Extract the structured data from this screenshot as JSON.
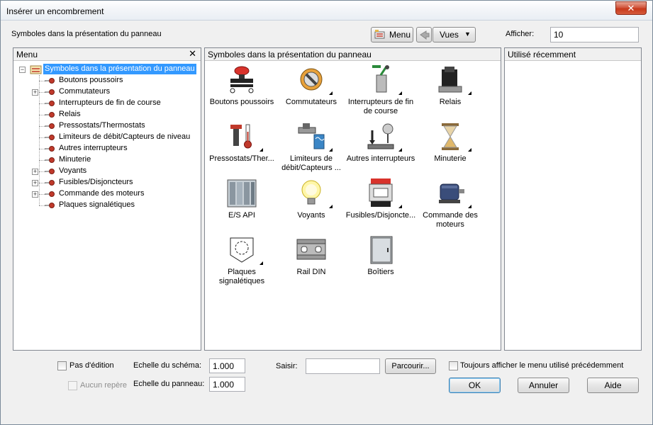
{
  "window": {
    "title": "Insérer un encombrement",
    "close_glyph": "✕"
  },
  "top": {
    "heading": "Symboles dans la présentation du panneau",
    "menu_button": "Menu",
    "views_button": "Vues",
    "show_label": "Afficher:",
    "show_value": "10"
  },
  "menu_panel": {
    "header": "Menu",
    "close_glyph": "✕",
    "root": "Symboles dans la présentation du panneau",
    "items": [
      {
        "label": "Boutons poussoirs",
        "expandable": false
      },
      {
        "label": "Commutateurs",
        "expandable": true
      },
      {
        "label": "Interrupteurs de fin de course",
        "expandable": false
      },
      {
        "label": "Relais",
        "expandable": false
      },
      {
        "label": "Pressostats/Thermostats",
        "expandable": false
      },
      {
        "label": "Limiteurs de débit/Capteurs de niveau",
        "expandable": false
      },
      {
        "label": "Autres interrupteurs",
        "expandable": false
      },
      {
        "label": "Minuterie",
        "expandable": false
      },
      {
        "label": "Voyants",
        "expandable": true
      },
      {
        "label": "Fusibles/Disjoncteurs",
        "expandable": true
      },
      {
        "label": "Commande des moteurs",
        "expandable": true
      },
      {
        "label": "Plaques signalétiques",
        "expandable": false
      }
    ]
  },
  "symbols_panel": {
    "header": "Symboles dans la présentation du panneau",
    "items": [
      {
        "label": "Boutons poussoirs",
        "icon": "push-button-icon",
        "more": false
      },
      {
        "label": "Commutateurs",
        "icon": "selector-switch-icon",
        "more": true
      },
      {
        "label": "Interrupteurs de fin de course",
        "icon": "limit-switch-icon",
        "more": true
      },
      {
        "label": "Relais",
        "icon": "relay-icon",
        "more": true
      },
      {
        "label": "Pressostats/Ther...",
        "icon": "thermostat-icon",
        "more": true
      },
      {
        "label": "Limiteurs de débit/Capteurs ...",
        "icon": "flow-sensor-icon",
        "more": true
      },
      {
        "label": "Autres interrupteurs",
        "icon": "other-switch-icon",
        "more": true
      },
      {
        "label": "Minuterie",
        "icon": "hourglass-icon",
        "more": true
      },
      {
        "label": "E/S API",
        "icon": "plc-io-icon",
        "more": false
      },
      {
        "label": "Voyants",
        "icon": "light-bulb-icon",
        "more": true
      },
      {
        "label": "Fusibles/Disjoncte...",
        "icon": "fuse-icon",
        "more": true
      },
      {
        "label": "Commande des moteurs",
        "icon": "motor-icon",
        "more": true
      },
      {
        "label": "Plaques signalétiques",
        "icon": "nameplate-icon",
        "more": true
      },
      {
        "label": "Rail DIN",
        "icon": "din-rail-icon",
        "more": false
      },
      {
        "label": "Boîtiers",
        "icon": "enclosure-icon",
        "more": false
      }
    ]
  },
  "recent_panel": {
    "header": "Utilisé récemment"
  },
  "bottom": {
    "no_edit": "Pas d'édition",
    "no_tag": "Aucun repère",
    "schema_scale_label": "Echelle du schéma:",
    "schema_scale_value": "1.000",
    "panel_scale_label": "Echelle du panneau:",
    "panel_scale_value": "1.000",
    "input_label": "Saisir:",
    "input_value": "",
    "browse": "Parcourir...",
    "always_show": "Toujours afficher le menu utilisé précédemment",
    "ok": "OK",
    "cancel": "Annuler",
    "help": "Aide"
  },
  "colors": {
    "selection": "#3399ff",
    "close_red": "#c7381b"
  }
}
